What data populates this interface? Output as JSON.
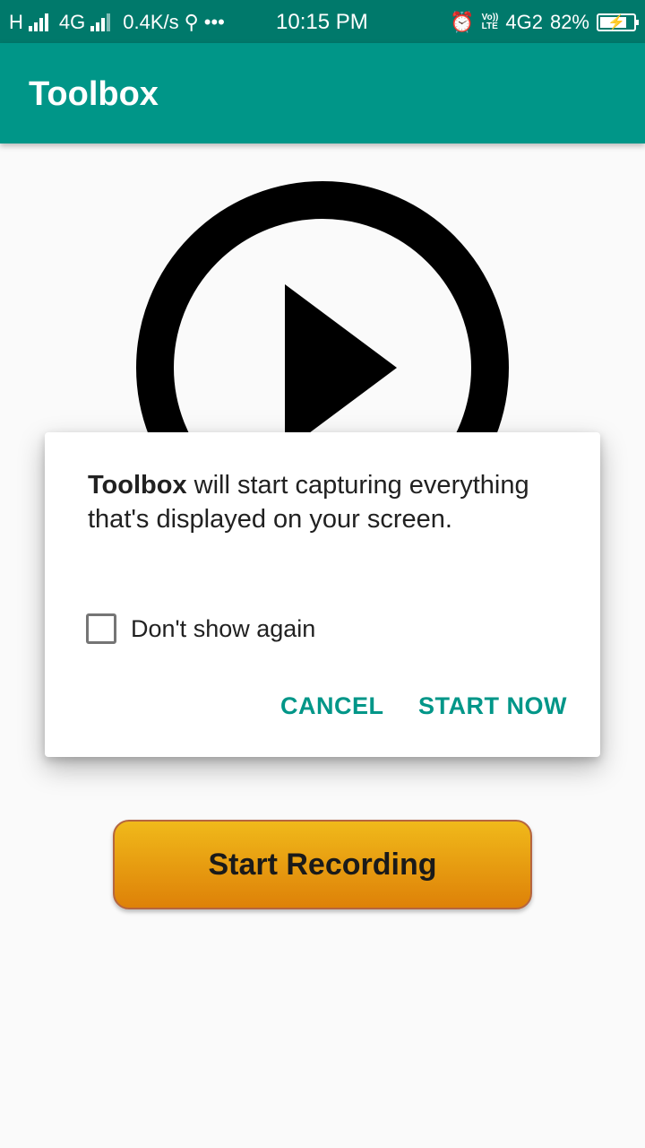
{
  "status_bar": {
    "network_type": "H",
    "network_gen": "4G",
    "data_speed": "0.4K/s",
    "more_dots": "•••",
    "time": "10:15 PM",
    "volte_top": "Vo))",
    "volte_bottom": "LTE",
    "sim2_network": "4G2",
    "battery_percent": "82%",
    "battery_level": 0.82
  },
  "app_bar": {
    "title": "Toolbox",
    "color": "#009688"
  },
  "main": {
    "play_icon": "play-circle-icon",
    "record_button_label": "Start Recording"
  },
  "dialog": {
    "app_name": "Toolbox",
    "message_rest": " will start capturing everything that's displayed on your screen.",
    "checkbox_label": "Don't show again",
    "checkbox_checked": false,
    "cancel_label": "CANCEL",
    "confirm_label": "START NOW",
    "accent_color": "#009688"
  }
}
